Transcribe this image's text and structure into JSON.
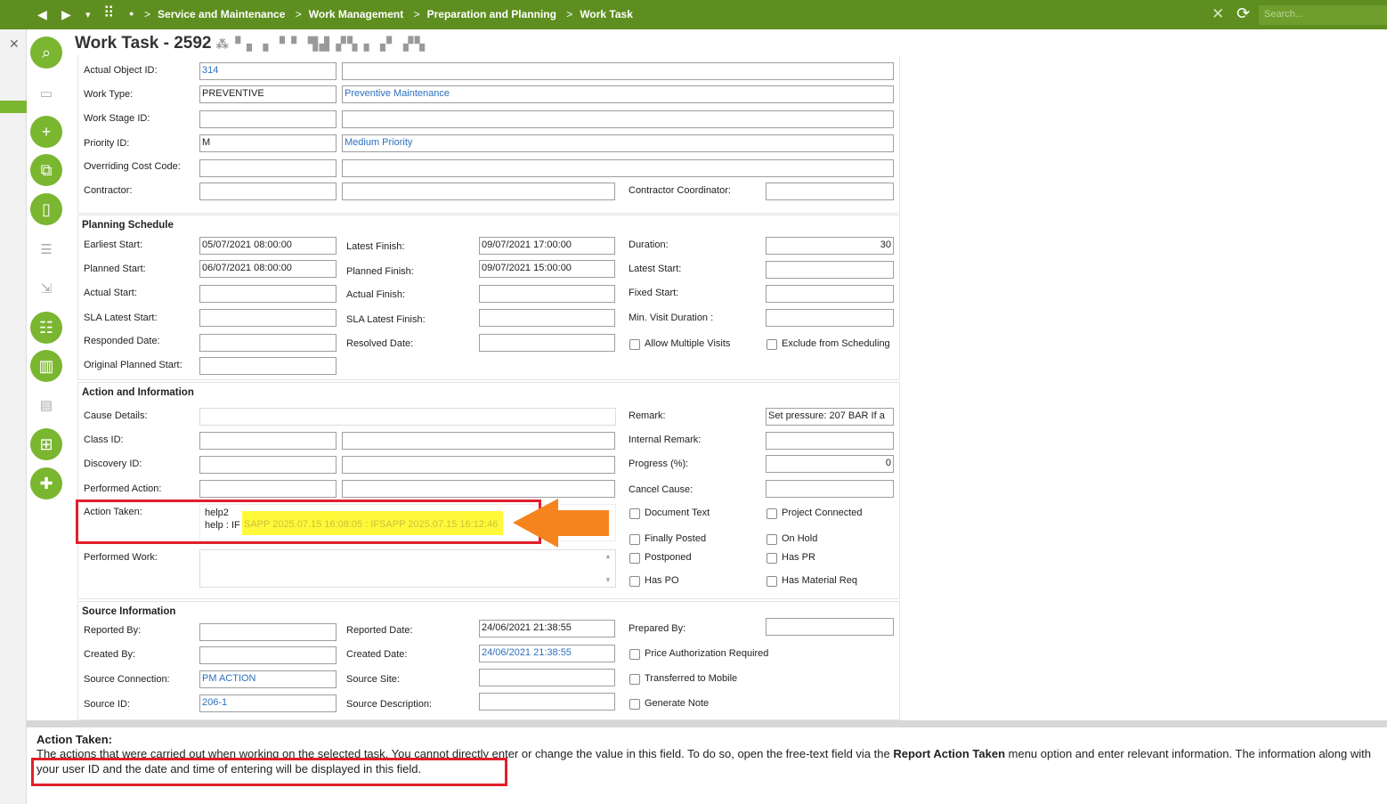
{
  "topbar": {
    "back": "◀",
    "forward": "▶",
    "menu": "▾",
    "apps": "⠿",
    "dot": "●",
    "breadcrumb": [
      "Service and Maintenance",
      "Work Management",
      "Preparation and Planning",
      "Work Task"
    ],
    "search_placeholder": "Search..."
  },
  "page": {
    "title": "Work Task - 2592",
    "title_redacted": "⁂ ▘▖▗ ▝ ▘ ▜▟ ▞▚ ▖▗▘ ▞▚"
  },
  "general": {
    "actual_object_id_label": "Actual Object ID:",
    "actual_object_id": "314",
    "actual_object_desc": "",
    "work_type_label": "Work Type:",
    "work_type": "PREVENTIVE",
    "work_type_desc": "Preventive Maintenance",
    "work_stage_label": "Work Stage ID:",
    "priority_label": "Priority ID:",
    "priority": "M",
    "priority_desc": "Medium Priority",
    "cost_code_label": "Overriding Cost Code:",
    "contractor_label": "Contractor:",
    "contractor_coord_label": "Contractor Coordinator:"
  },
  "planning": {
    "section": "Planning Schedule",
    "earliest_start_label": "Earliest Start:",
    "earliest_start": "05/07/2021 08:00:00",
    "latest_finish_label": "Latest Finish:",
    "latest_finish": "09/07/2021 17:00:00",
    "duration_label": "Duration:",
    "duration": "30",
    "planned_start_label": "Planned Start:",
    "planned_start": "06/07/2021 08:00:00",
    "planned_finish_label": "Planned Finish:",
    "planned_finish": "09/07/2021 15:00:00",
    "latest_start_label": "Latest Start:",
    "actual_start_label": "Actual Start:",
    "actual_finish_label": "Actual Finish:",
    "fixed_start_label": "Fixed Start:",
    "sla_latest_start_label": "SLA Latest Start:",
    "sla_latest_finish_label": "SLA Latest Finish:",
    "min_visit_label": "Min. Visit Duration :",
    "responded_label": "Responded Date:",
    "resolved_label": "Resolved Date:",
    "allow_multiple_label": "Allow Multiple Visits",
    "exclude_label": "Exclude from Scheduling",
    "original_planned_label": "Original Planned Start:"
  },
  "action": {
    "section": "Action and Information",
    "cause_label": "Cause Details:",
    "remark_label": "Remark:",
    "remark": "Set pressure: 207 BAR       If a",
    "class_label": "Class ID:",
    "internal_remark_label": "Internal Remark:",
    "discovery_label": "Discovery ID:",
    "progress_label": "Progress (%):",
    "progress": "0",
    "performed_action_label": "Performed Action:",
    "cancel_cause_label": "Cancel Cause:",
    "action_taken_label": "Action Taken:",
    "action_taken_line1": "help2",
    "action_taken_line2": "help  : IF",
    "action_taken_highlight": "SAPP 2025.07.15 16:08:05 : IFSAPP 2025.07.15 16:12:46",
    "document_text_label": "Document Text",
    "project_connected_label": "Project Connected",
    "finally_posted_label": "Finally Posted",
    "on_hold_label": "On Hold",
    "performed_work_label": "Performed Work:",
    "postponed_label": "Postponed",
    "has_pr_label": "Has PR",
    "has_po_label": "Has PO",
    "has_material_label": "Has Material Req"
  },
  "source": {
    "section": "Source Information",
    "reported_by_label": "Reported By:",
    "reported_date_label": "Reported Date:",
    "reported_date": "24/06/2021 21:38:55",
    "prepared_by_label": "Prepared By:",
    "created_by_label": "Created By:",
    "created_date_label": "Created Date:",
    "created_date": "24/06/2021 21:38:55",
    "price_auth_label": "Price Authorization Required",
    "source_conn_label": "Source Connection:",
    "source_conn": "PM ACTION",
    "source_site_label": "Source Site:",
    "transferred_label": "Transferred to Mobile",
    "source_id_label": "Source ID:",
    "source_id": "206-1",
    "source_desc_label": "Source Description:",
    "generate_note_label": "Generate Note"
  },
  "help": {
    "title": "Action Taken:",
    "text_part1": "The actions that were carried out when working on the selected task. You cannot directly enter or change the value in this field. To do so, open the free-text field via the ",
    "text_bold": "Report Action Taken",
    "text_part2": " menu option and enter relevant information. The information along with your user ID and the date and time of entering will be displayed in this field."
  },
  "colors": {
    "topbar": "#5e8e1f",
    "accent": "#7ab630",
    "highlight_box": "#e0202a",
    "arrow": "#f5841f",
    "marker": "#fff93a"
  }
}
